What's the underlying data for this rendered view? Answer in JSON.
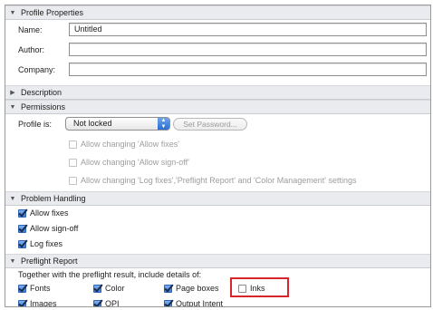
{
  "profile_properties": {
    "title": "Profile Properties",
    "name_label": "Name:",
    "name_value": "Untitled",
    "author_label": "Author:",
    "author_value": "",
    "company_label": "Company:",
    "company_value": ""
  },
  "description": {
    "title": "Description"
  },
  "permissions": {
    "title": "Permissions",
    "profile_is_label": "Profile is:",
    "profile_is_value": "Not locked",
    "set_password_label": "Set Password...",
    "options": [
      {
        "label": "Allow changing 'Allow fixes'",
        "checked": false
      },
      {
        "label": "Allow changing 'Allow sign-off'",
        "checked": false
      },
      {
        "label": "Allow changing 'Log fixes','Preflight Report' and 'Color Management' settings",
        "checked": false
      }
    ]
  },
  "problem_handling": {
    "title": "Problem Handling",
    "options": [
      {
        "label": "Allow fixes",
        "checked": true
      },
      {
        "label": "Allow sign-off",
        "checked": true
      },
      {
        "label": "Log fixes",
        "checked": true
      }
    ]
  },
  "preflight_report": {
    "title": "Preflight Report",
    "intro": "Together with the preflight result, include details of:",
    "options": [
      {
        "label": "Fonts",
        "checked": true
      },
      {
        "label": "Color",
        "checked": true
      },
      {
        "label": "Page boxes",
        "checked": true
      },
      {
        "label": "Inks",
        "checked": false
      },
      {
        "label": "Images",
        "checked": true
      },
      {
        "label": "OPI",
        "checked": true
      },
      {
        "label": "Output Intent",
        "checked": true
      }
    ]
  },
  "colors": {
    "highlight": "#d6262b",
    "checkbox_on": "#3c7ddb",
    "section_bg": "#e9ebee"
  },
  "icons": {
    "expanded": "triangle-down-icon",
    "collapsed": "triangle-right-icon"
  }
}
